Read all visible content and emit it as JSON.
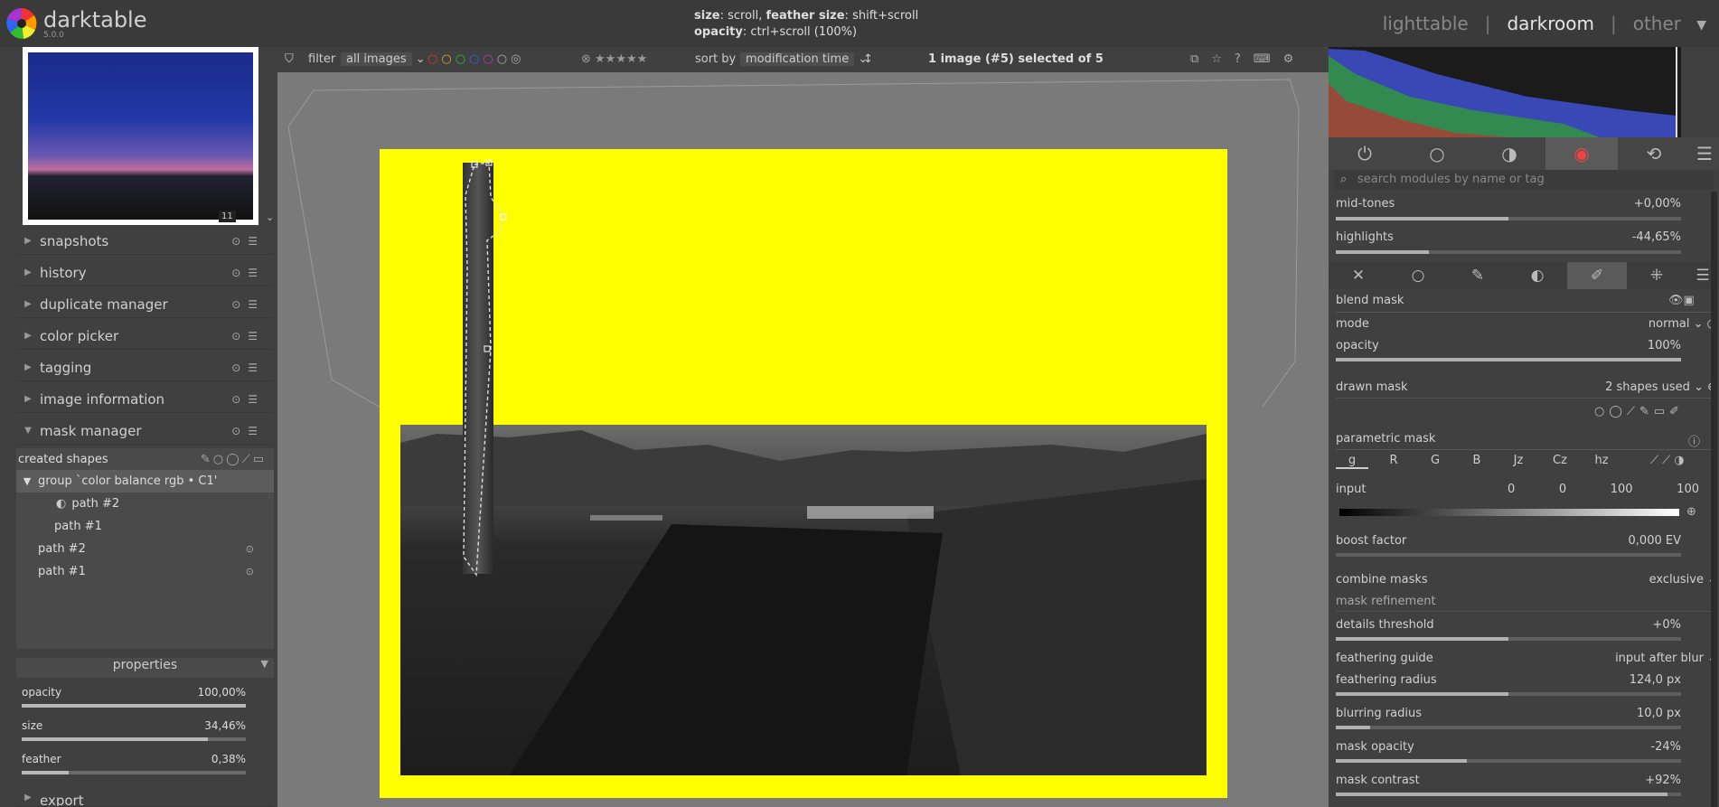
{
  "app": {
    "name": "darktable",
    "version": "5.0.0"
  },
  "hint": {
    "size_label": "size",
    "size_text": ": scroll, ",
    "feather_label": "feather size",
    "feather_text": ": shift+scroll",
    "opacity_label": "opacity",
    "opacity_text": ": ctrl+scroll (100%)"
  },
  "views": {
    "lighttable": "lighttable",
    "sep": "|",
    "darkroom": "darkroom",
    "other": "other"
  },
  "thumbnail": {
    "zoom_badge": "11"
  },
  "left_modules": [
    {
      "label": "snapshots",
      "expanded": false
    },
    {
      "label": "history",
      "expanded": false
    },
    {
      "label": "duplicate manager",
      "expanded": false
    },
    {
      "label": "color picker",
      "expanded": false
    },
    {
      "label": "tagging",
      "expanded": false
    },
    {
      "label": "image information",
      "expanded": false
    },
    {
      "label": "mask manager",
      "expanded": true
    }
  ],
  "mask_manager": {
    "created_shapes": "created shapes",
    "group": "group `color balance rgb • C1'",
    "group_children": [
      "path #2",
      "path #1"
    ],
    "items": [
      "path #2",
      "path #1"
    ]
  },
  "properties": {
    "title": "properties",
    "opacity": {
      "label": "opacity",
      "value": "100,00%",
      "level": 1.0
    },
    "size": {
      "label": "size",
      "value": "34,46%",
      "level": 0.83
    },
    "feather": {
      "label": "feather",
      "value": "0,38%",
      "level": 0.21
    }
  },
  "export_label": "export",
  "filterbar": {
    "filter_label": "filter",
    "filter_value": "all images",
    "sort_label": "sort by",
    "sort_value": "modification time",
    "count_prefix": "1 image (#",
    "count_num": "5",
    "count_suffix": ") selected of ",
    "count_total": "5"
  },
  "search": {
    "placeholder": "search modules by name or tag"
  },
  "tone": {
    "midtones": {
      "label": "mid-tones",
      "value": "+0,00%",
      "level": 0.5
    },
    "highlights": {
      "label": "highlights",
      "value": "-44,65%",
      "level": 0.27
    }
  },
  "blend": {
    "blend_mask": "blend mask",
    "mode_label": "mode",
    "mode_value": "normal",
    "opacity_label": "opacity",
    "opacity_value": "100%",
    "opacity_level": 1.0,
    "drawn_mask": "drawn mask",
    "drawn_value": "2 shapes used",
    "parametric_mask": "parametric mask",
    "channels": [
      "g",
      "R",
      "G",
      "B",
      "Jz",
      "Cz",
      "hz"
    ],
    "input_label": "input",
    "input_values": [
      "0",
      "0",
      "100",
      "100"
    ],
    "boost_label": "boost factor",
    "boost_value": "0,000 EV",
    "combine_label": "combine masks",
    "combine_value": "exclusive",
    "refinement": "mask refinement",
    "details_label": "details threshold",
    "details_value": "+0%",
    "details_level": 0.5,
    "guide_label": "feathering guide",
    "guide_value": "input after blur",
    "fradius_label": "feathering radius",
    "fradius_value": "124,0 px",
    "fradius_level": 0.5,
    "bradius_label": "blurring radius",
    "bradius_value": "10,0 px",
    "bradius_level": 0.1,
    "mopacity_label": "mask opacity",
    "mopacity_value": "-24%",
    "mopacity_level": 0.38,
    "mcontrast_label": "mask contrast",
    "mcontrast_value": "+92%",
    "mcontrast_level": 0.96
  },
  "colors": {
    "mask_yellow": "#ffff00",
    "accent_tab": "#5a5a5a"
  }
}
